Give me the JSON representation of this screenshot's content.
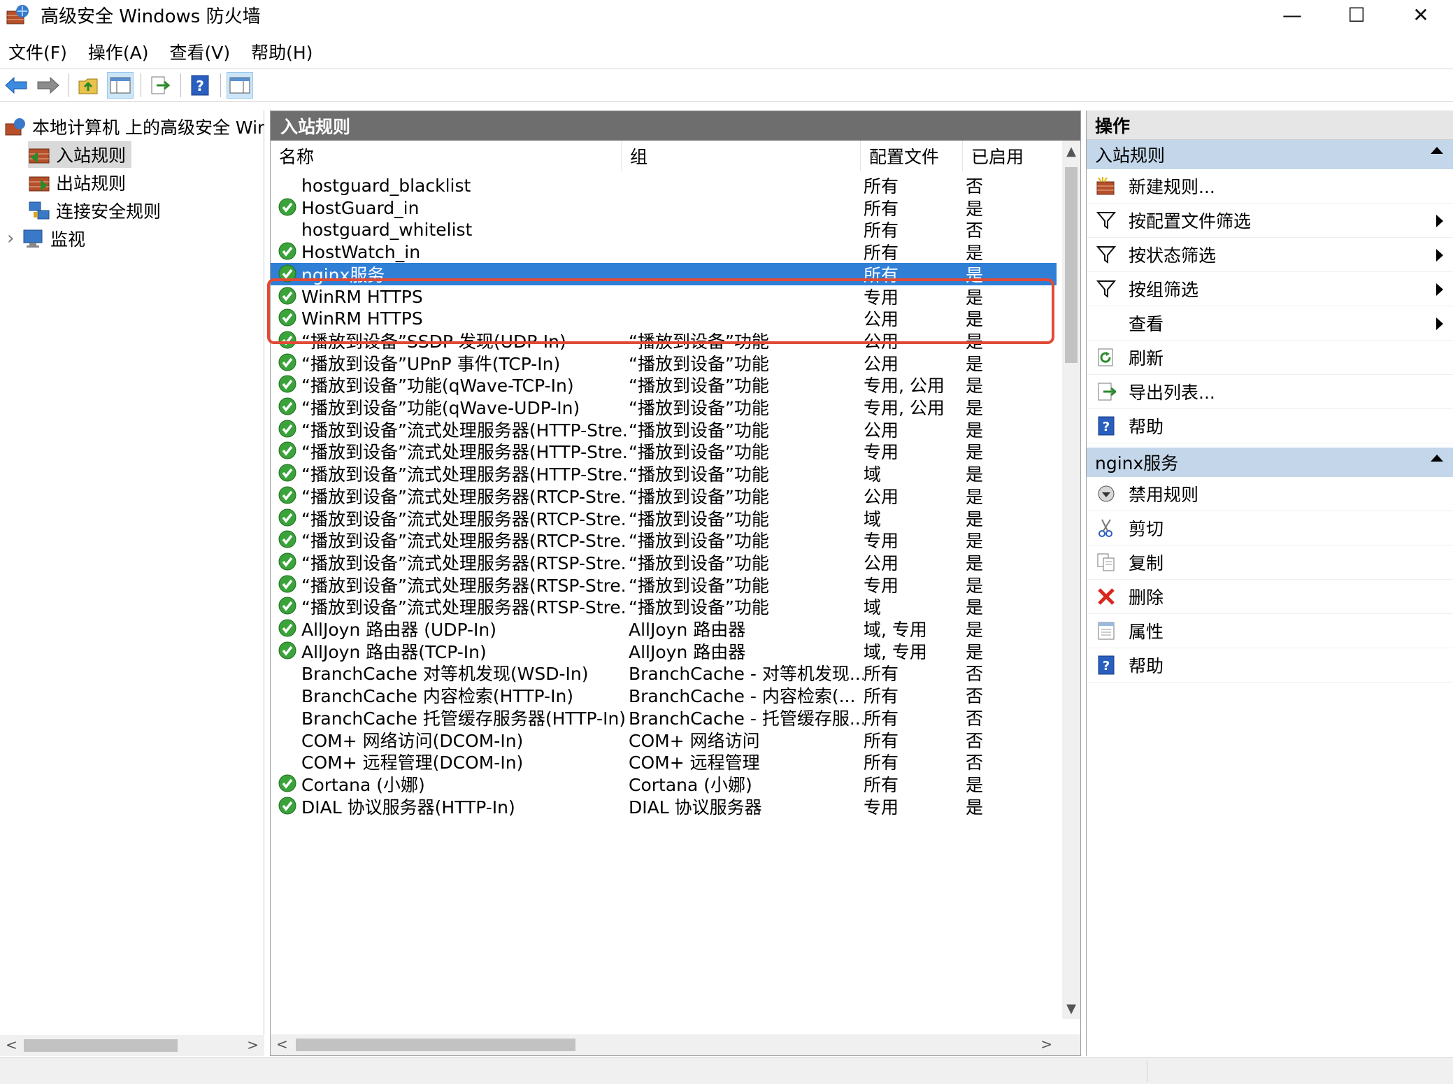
{
  "window": {
    "title": "高级安全 Windows 防火墙",
    "minimize": "—",
    "maximize": "☐",
    "close": "✕"
  },
  "menu": [
    "文件(F)",
    "操作(A)",
    "查看(V)",
    "帮助(H)"
  ],
  "tree": {
    "root": "本地计算机 上的高级安全 Windows 防火墙",
    "items": [
      "入站规则",
      "出站规则",
      "连接安全规则",
      "监视"
    ],
    "expander": "›"
  },
  "main": {
    "header": "入站规则",
    "columns": [
      "名称",
      "组",
      "配置文件",
      "已启用"
    ],
    "rows": [
      {
        "name": "hostguard_blacklist",
        "group": "",
        "profile": "所有",
        "enabled": "否",
        "icon": false
      },
      {
        "name": "HostGuard_in",
        "group": "",
        "profile": "所有",
        "enabled": "是",
        "icon": true
      },
      {
        "name": "hostguard_whitelist",
        "group": "",
        "profile": "所有",
        "enabled": "否",
        "icon": false
      },
      {
        "name": "HostWatch_in",
        "group": "",
        "profile": "所有",
        "enabled": "是",
        "icon": true
      },
      {
        "name": "nginx服务",
        "group": "",
        "profile": "所有",
        "enabled": "是",
        "icon": true,
        "selected": true
      },
      {
        "name": "WinRM HTTPS",
        "group": "",
        "profile": "专用",
        "enabled": "是",
        "icon": true
      },
      {
        "name": "WinRM HTTPS",
        "group": "",
        "profile": "公用",
        "enabled": "是",
        "icon": true
      },
      {
        "name": "“播放到设备”SSDP 发现(UDP-In)",
        "group": "“播放到设备”功能",
        "profile": "公用",
        "enabled": "是",
        "icon": true
      },
      {
        "name": "“播放到设备”UPnP 事件(TCP-In)",
        "group": "“播放到设备”功能",
        "profile": "公用",
        "enabled": "是",
        "icon": true
      },
      {
        "name": "“播放到设备”功能(qWave-TCP-In)",
        "group": "“播放到设备”功能",
        "profile": "专用, 公用",
        "enabled": "是",
        "icon": true
      },
      {
        "name": "“播放到设备”功能(qWave-UDP-In)",
        "group": "“播放到设备”功能",
        "profile": "专用, 公用",
        "enabled": "是",
        "icon": true
      },
      {
        "name": "“播放到设备”流式处理服务器(HTTP-Stre...",
        "group": "“播放到设备”功能",
        "profile": "公用",
        "enabled": "是",
        "icon": true
      },
      {
        "name": "“播放到设备”流式处理服务器(HTTP-Stre...",
        "group": "“播放到设备”功能",
        "profile": "专用",
        "enabled": "是",
        "icon": true
      },
      {
        "name": "“播放到设备”流式处理服务器(HTTP-Stre...",
        "group": "“播放到设备”功能",
        "profile": "域",
        "enabled": "是",
        "icon": true
      },
      {
        "name": "“播放到设备”流式处理服务器(RTCP-Stre...",
        "group": "“播放到设备”功能",
        "profile": "公用",
        "enabled": "是",
        "icon": true
      },
      {
        "name": "“播放到设备”流式处理服务器(RTCP-Stre...",
        "group": "“播放到设备”功能",
        "profile": "域",
        "enabled": "是",
        "icon": true
      },
      {
        "name": "“播放到设备”流式处理服务器(RTCP-Stre...",
        "group": "“播放到设备”功能",
        "profile": "专用",
        "enabled": "是",
        "icon": true
      },
      {
        "name": "“播放到设备”流式处理服务器(RTSP-Stre...",
        "group": "“播放到设备”功能",
        "profile": "公用",
        "enabled": "是",
        "icon": true
      },
      {
        "name": "“播放到设备”流式处理服务器(RTSP-Stre...",
        "group": "“播放到设备”功能",
        "profile": "专用",
        "enabled": "是",
        "icon": true
      },
      {
        "name": "“播放到设备”流式处理服务器(RTSP-Stre...",
        "group": "“播放到设备”功能",
        "profile": "域",
        "enabled": "是",
        "icon": true
      },
      {
        "name": "AllJoyn 路由器 (UDP-In)",
        "group": "AllJoyn 路由器",
        "profile": "域, 专用",
        "enabled": "是",
        "icon": true
      },
      {
        "name": "AllJoyn 路由器(TCP-In)",
        "group": "AllJoyn 路由器",
        "profile": "域, 专用",
        "enabled": "是",
        "icon": true
      },
      {
        "name": "BranchCache 对等机发现(WSD-In)",
        "group": "BranchCache - 对等机发现...",
        "profile": "所有",
        "enabled": "否",
        "icon": false
      },
      {
        "name": "BranchCache 内容检索(HTTP-In)",
        "group": "BranchCache - 内容检索(...",
        "profile": "所有",
        "enabled": "否",
        "icon": false
      },
      {
        "name": "BranchCache 托管缓存服务器(HTTP-In)",
        "group": "BranchCache - 托管缓存服...",
        "profile": "所有",
        "enabled": "否",
        "icon": false
      },
      {
        "name": "COM+ 网络访问(DCOM-In)",
        "group": "COM+ 网络访问",
        "profile": "所有",
        "enabled": "否",
        "icon": false
      },
      {
        "name": "COM+ 远程管理(DCOM-In)",
        "group": "COM+ 远程管理",
        "profile": "所有",
        "enabled": "否",
        "icon": false
      },
      {
        "name": "Cortana (小娜)",
        "group": "Cortana (小娜)",
        "profile": "所有",
        "enabled": "是",
        "icon": true
      },
      {
        "name": "DIAL 协议服务器(HTTP-In)",
        "group": "DIAL 协议服务器",
        "profile": "专用",
        "enabled": "是",
        "icon": true
      }
    ]
  },
  "actions": {
    "title": "操作",
    "section1": {
      "label": "入站规则",
      "items": [
        {
          "label": "新建规则...",
          "icon": "new-rule-icon",
          "submenu": false
        },
        {
          "label": "按配置文件筛选",
          "icon": "filter-icon",
          "submenu": true
        },
        {
          "label": "按状态筛选",
          "icon": "filter-icon",
          "submenu": true
        },
        {
          "label": "按组筛选",
          "icon": "filter-icon",
          "submenu": true
        },
        {
          "label": "查看",
          "icon": "",
          "submenu": true
        },
        {
          "label": "刷新",
          "icon": "refresh-icon",
          "submenu": false
        },
        {
          "label": "导出列表...",
          "icon": "export-icon",
          "submenu": false
        },
        {
          "label": "帮助",
          "icon": "help-icon",
          "submenu": false
        }
      ]
    },
    "section2": {
      "label": "nginx服务",
      "items": [
        {
          "label": "禁用规则",
          "icon": "disable-icon"
        },
        {
          "label": "剪切",
          "icon": "cut-icon"
        },
        {
          "label": "复制",
          "icon": "copy-icon"
        },
        {
          "label": "删除",
          "icon": "delete-icon"
        },
        {
          "label": "属性",
          "icon": "properties-icon"
        },
        {
          "label": "帮助",
          "icon": "help-icon"
        }
      ]
    }
  },
  "colors": {
    "selection": "#2f7fd6",
    "header": "#6e6e6e",
    "section": "#c4d7ea",
    "highlight": "#e14b35",
    "check": "#3aa33a"
  }
}
